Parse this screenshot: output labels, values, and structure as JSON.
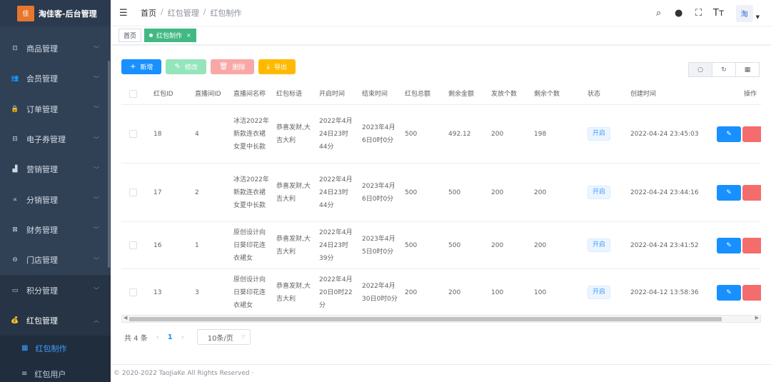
{
  "app": {
    "title": "淘佳客-后台管理",
    "logo_text": "佳"
  },
  "sidebar": {
    "items": [
      {
        "label": "商品管理",
        "icon": "product-icon",
        "glyph": "⊡"
      },
      {
        "label": "会员管理",
        "icon": "user-icon",
        "glyph": "👥"
      },
      {
        "label": "订单管理",
        "icon": "lock-icon",
        "glyph": "🔒"
      },
      {
        "label": "电子券管理",
        "icon": "coupon-icon",
        "glyph": "⊟"
      },
      {
        "label": "营销管理",
        "icon": "chart-icon",
        "glyph": "▟"
      },
      {
        "label": "分销管理",
        "icon": "share-icon",
        "glyph": "∝"
      },
      {
        "label": "财务管理",
        "icon": "finance-icon",
        "glyph": "⊠"
      },
      {
        "label": "门店管理",
        "icon": "store-icon",
        "glyph": "⊖"
      },
      {
        "label": "积分管理",
        "icon": "points-icon",
        "glyph": "▭"
      },
      {
        "label": "红包管理",
        "icon": "redpacket-icon",
        "glyph": "💰"
      }
    ],
    "sub_items": [
      {
        "label": "红包制作",
        "glyph": "▦"
      },
      {
        "label": "红包用户",
        "glyph": "≡"
      }
    ]
  },
  "header": {
    "breadcrumb": [
      "首页",
      "红包管理",
      "红包制作"
    ],
    "avatar_text": "淘"
  },
  "tags": {
    "home": "首页",
    "active": "红包制作",
    "close": "×"
  },
  "toolbar": {
    "add": "新增",
    "edit": "修改",
    "delete": "删除",
    "export": "导出"
  },
  "table": {
    "headers": {
      "id": "红包ID",
      "room": "直播间ID",
      "name": "直播间名称",
      "slogan": "红包标语",
      "start": "开启时间",
      "end": "结束时间",
      "total": "红包总额",
      "left": "剩余金额",
      "cnt": "发放个数",
      "rem": "剩余个数",
      "status": "状态",
      "time": "创建时间",
      "ops": "操作"
    },
    "rows": [
      {
        "id": "18",
        "room": "4",
        "name": "冰洁2022年新款连衣裙女夏中长款",
        "slogan": "恭喜发财,大吉大利",
        "start": "2022年4月24日23时44分",
        "end": "2023年4月6日0时0分",
        "total": "500",
        "left": "492.12",
        "cnt": "200",
        "rem": "198",
        "status": "开启",
        "time": "2022-04-24 23:45:03"
      },
      {
        "id": "17",
        "room": "2",
        "name": "冰洁2022年新款连衣裙女夏中长款",
        "slogan": "恭喜发财,大吉大利",
        "start": "2022年4月24日23时44分",
        "end": "2023年4月6日0时0分",
        "total": "500",
        "left": "500",
        "cnt": "200",
        "rem": "200",
        "status": "开启",
        "time": "2022-04-24 23:44:16"
      },
      {
        "id": "16",
        "room": "1",
        "name": "原创设计向日葵印花连衣裙女",
        "slogan": "恭喜发财,大吉大利",
        "start": "2022年4月24日23时39分",
        "end": "2023年4月5日0时0分",
        "total": "500",
        "left": "500",
        "cnt": "200",
        "rem": "200",
        "status": "开启",
        "time": "2022-04-24 23:41:52"
      },
      {
        "id": "13",
        "room": "3",
        "name": "原创设计向日葵印花连衣裙女",
        "slogan": "恭喜发财,大吉大利",
        "start": "2022年4月20日0时22分",
        "end": "2022年4月30日0时0分",
        "total": "200",
        "left": "200",
        "cnt": "100",
        "rem": "100",
        "status": "开启",
        "time": "2022-04-12 13:58:36"
      }
    ]
  },
  "pagination": {
    "total": "共 4 条",
    "page": "1",
    "size": "10条/页"
  },
  "footer": {
    "text": "© 2020-2022 TaoJiaKe All Rights Reserved ·"
  },
  "colors": {
    "primary": "#1890ff",
    "sidebar": "#304156",
    "tag_active": "#42b983",
    "danger": "#f56c6c",
    "warning": "#ffba00"
  }
}
